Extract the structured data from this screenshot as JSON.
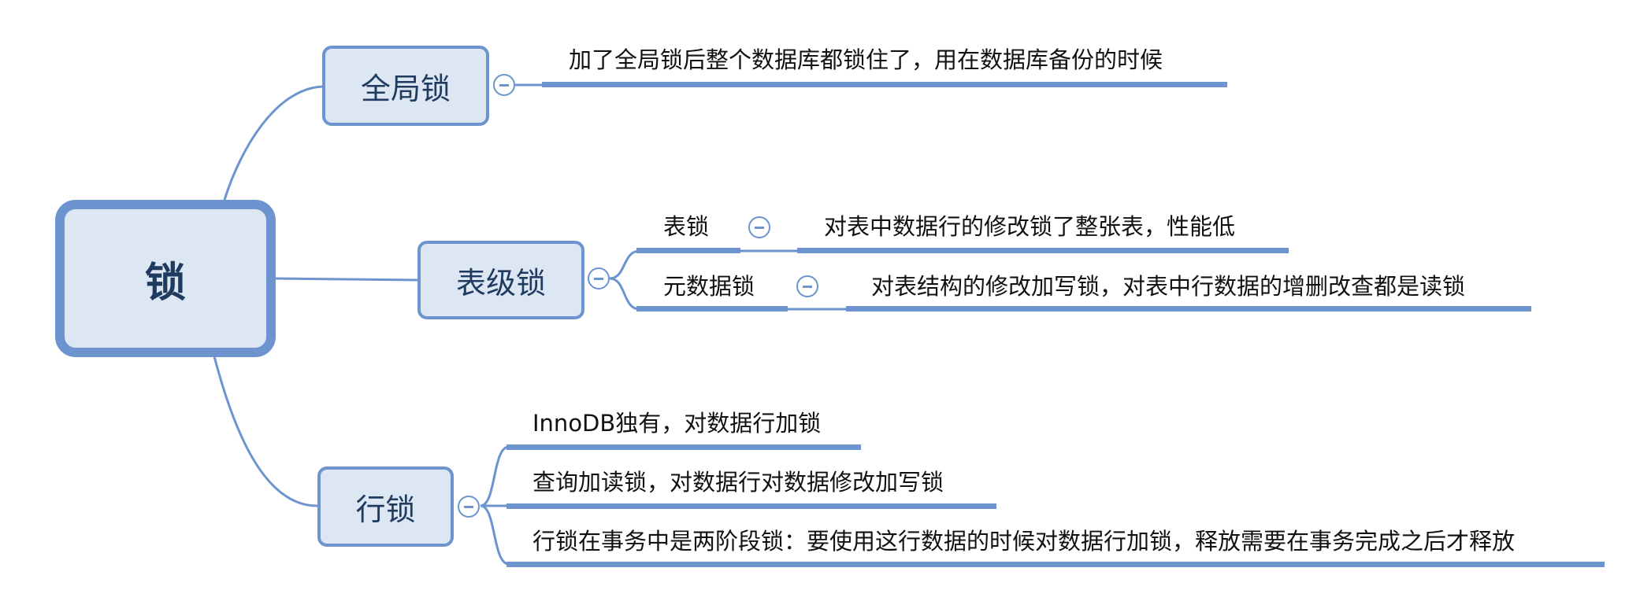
{
  "root": {
    "label": "锁"
  },
  "branches": [
    {
      "label": "全局锁",
      "note": "加了全局锁后整个数据库都锁住了，用在数据库备份的时候"
    },
    {
      "label": "表级锁",
      "children": [
        {
          "label": "表锁",
          "note": "对表中数据行的修改锁了整张表，性能低"
        },
        {
          "label": "元数据锁",
          "note": "对表结构的修改加写锁，对表中行数据的增删改查都是读锁"
        }
      ]
    },
    {
      "label": "行锁",
      "items": [
        "InnoDB独有，对数据行加锁",
        "查询加读锁，对数据行对数据修改加写锁",
        "行锁在事务中是两阶段锁：要使用这行数据的时候对数据行加锁，释放需要在事务完成之后才释放"
      ]
    }
  ],
  "colors": {
    "line": "#6d94cf",
    "node_fill": "#dde6f3",
    "node_text": "#1f3b60"
  },
  "icons": {
    "toggle": "collapse-minus-icon"
  }
}
